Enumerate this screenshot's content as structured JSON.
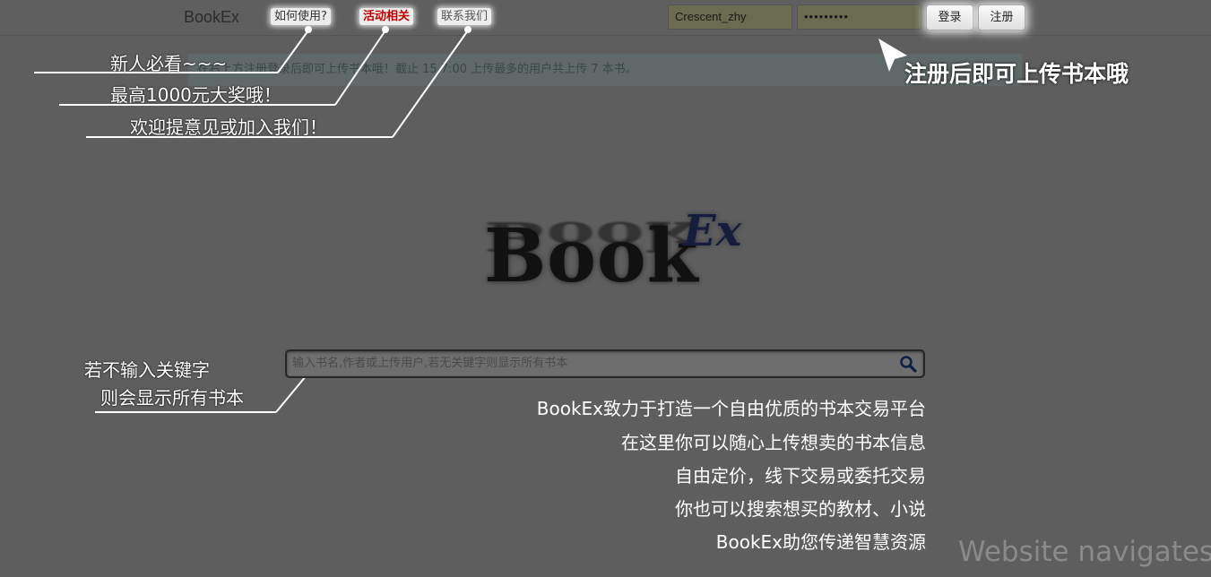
{
  "header": {
    "brand": "BookEx",
    "nav": [
      {
        "label": "如何使用?",
        "color": "#333333"
      },
      {
        "label": "活动相关",
        "color": "#c00000"
      },
      {
        "label": "联系我们",
        "color": "#555555"
      }
    ],
    "username_value": "Crescent_zhy",
    "password_value": "•••••••••",
    "login_label": "登录",
    "register_label": "注册"
  },
  "notice": "在右上方注册登录后即可上传书本哦！截止 15 7:00 上传最多的用户共上传 7 本书。",
  "annotations": {
    "new_users": "新人必看~~~",
    "prize": "最高1000元大奖哦！",
    "feedback": "欢迎提意见或加入我们！",
    "register_hint": "注册后即可上传书本哦",
    "search_hint_line1": "若不输入关键字",
    "search_hint_line2": "则会显示所有书本"
  },
  "logo": {
    "main": "Book",
    "sup": "Ex"
  },
  "search": {
    "placeholder": "输入书名,作者或上传用户,若无关键字则显示所有书本",
    "icon": "search-icon"
  },
  "slogans": [
    "BookEx致力于打造一个自由优质的书本交易平台",
    "在这里你可以随心上传想卖的书本信息",
    "自由定价，线下交易或委托交易",
    "你也可以搜索想买的教材、小说",
    "BookEx助您传递智慧资源"
  ],
  "watermark": "Website navigates",
  "colors": {
    "background": "#5e5e5e",
    "annotation": "#ffffff",
    "activity_link": "#c00000"
  }
}
